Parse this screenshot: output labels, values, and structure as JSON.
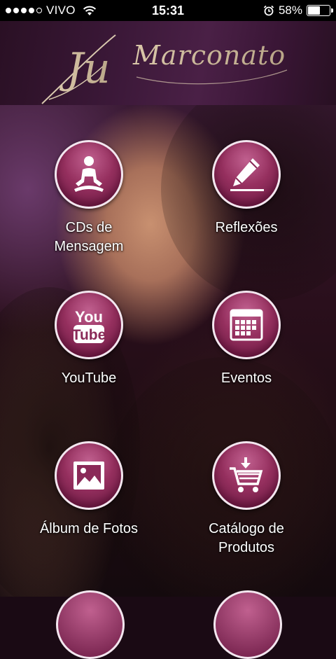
{
  "status_bar": {
    "carrier": "VIVO",
    "time": "15:31",
    "battery_percent": "58%",
    "battery_level": 0.58,
    "signal_bars_filled": 4,
    "signal_bars_total": 5
  },
  "header": {
    "logo_text_first": "Ju",
    "logo_text_last": "Marconato"
  },
  "menu": {
    "items": [
      {
        "label": "CDs de Mensagem",
        "icon": "meditation-icon"
      },
      {
        "label": "Reflexões",
        "icon": "pencil-icon"
      },
      {
        "label": "YouTube",
        "icon": "youtube-icon"
      },
      {
        "label": "Eventos",
        "icon": "calendar-icon"
      },
      {
        "label": "Álbum de Fotos",
        "icon": "photo-icon"
      },
      {
        "label": "Catálogo de Produtos",
        "icon": "cart-icon"
      }
    ]
  },
  "colors": {
    "button_dark": "#6c1a44",
    "button_light": "#c0608f",
    "button_border": "#f3e6ef",
    "header_bg": "#3b1838"
  }
}
